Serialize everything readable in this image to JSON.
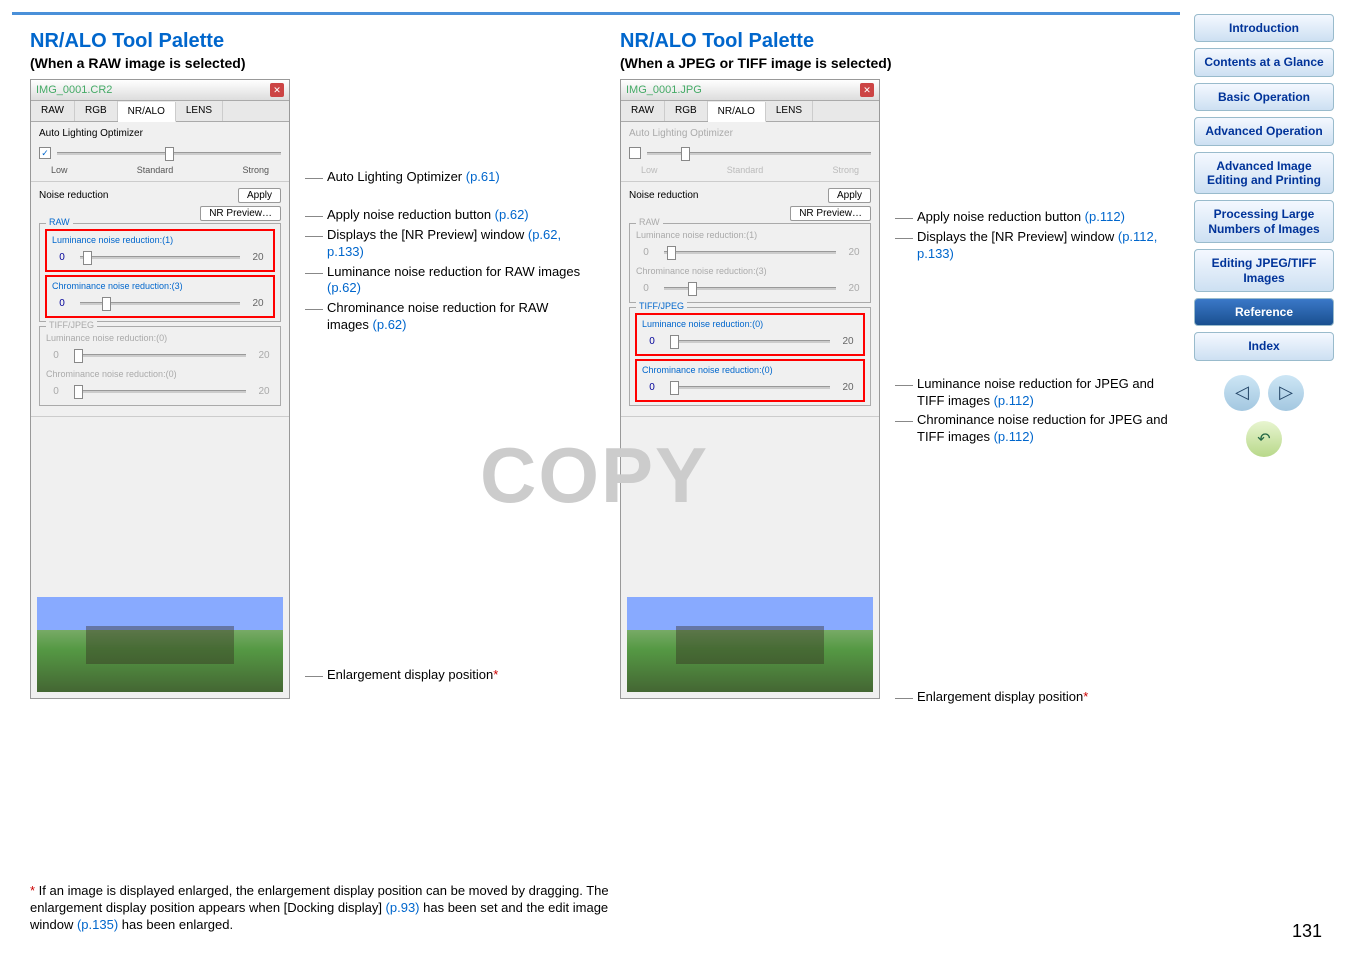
{
  "page_number": "131",
  "watermark": "COPY",
  "left": {
    "heading": "NR/ALO Tool Palette",
    "sub": "(When a RAW image is selected)",
    "panel": {
      "title": "IMG_0001.CR2",
      "tabs": [
        "RAW",
        "RGB",
        "NR/ALO",
        "LENS"
      ],
      "alo_title": "Auto Lighting Optimizer",
      "alo_labels": [
        "Low",
        "Standard",
        "Strong"
      ],
      "nr_title": "Noise reduction",
      "apply": "Apply",
      "nr_preview": "NR Preview…",
      "raw_label": "RAW",
      "lum_label": "Luminance noise reduction:(1)",
      "lum_val": "0",
      "lum_max": "20",
      "chrom_label": "Chrominance noise reduction:(3)",
      "chrom_val": "0",
      "chrom_max": "20",
      "tiff_label": "TIFF/JPEG",
      "tlum_label": "Luminance noise reduction:(0)",
      "tlum_val": "0",
      "tlum_max": "20",
      "tchrom_label": "Chrominance noise reduction:(0)",
      "tchrom_val": "0",
      "tchrom_max": "20"
    },
    "annot": {
      "a1": "Auto Lighting Optimizer ",
      "a1_link": "(p.61)",
      "a2": "Apply noise reduction button ",
      "a2_link": "(p.62)",
      "a3": "Displays the [NR Preview] window ",
      "a3_link": "(p.62, p.133)",
      "a4": "Luminance noise reduction for RAW images ",
      "a4_link": "(p.62)",
      "a5": "Chrominance noise reduction for RAW images ",
      "a5_link": "(p.62)",
      "a6": "Enlargement display position",
      "a6_star": "*"
    }
  },
  "right": {
    "heading": "NR/ALO Tool Palette",
    "sub": "(When a JPEG or TIFF image is selected)",
    "panel": {
      "title": "IMG_0001.JPG",
      "tabs": [
        "RAW",
        "RGB",
        "NR/ALO",
        "LENS"
      ],
      "alo_title": "Auto Lighting Optimizer",
      "alo_labels": [
        "Low",
        "Standard",
        "Strong"
      ],
      "nr_title": "Noise reduction",
      "apply": "Apply",
      "nr_preview": "NR Preview…",
      "raw_label": "RAW",
      "lum_label": "Luminance noise reduction:(1)",
      "lum_val": "0",
      "lum_max": "20",
      "chrom_label": "Chrominance noise reduction:(3)",
      "chrom_val": "0",
      "chrom_max": "20",
      "tiff_label": "TIFF/JPEG",
      "tlum_label": "Luminance noise reduction:(0)",
      "tlum_val": "0",
      "tlum_max": "20",
      "tchrom_label": "Chrominance noise reduction:(0)",
      "tchrom_val": "0",
      "tchrom_max": "20"
    },
    "annot": {
      "a2": "Apply noise reduction button ",
      "a2_link": "(p.112)",
      "a3": "Displays the [NR Preview] window ",
      "a3_link": "(p.112, p.133)",
      "a4": "Luminance noise reduction for JPEG and TIFF images ",
      "a4_link": "(p.112)",
      "a5": "Chrominance noise reduction for JPEG and TIFF images ",
      "a5_link": "(p.112)",
      "a6": "Enlargement display position",
      "a6_star": "*"
    }
  },
  "footnote": {
    "star": "*",
    "t1": " If an image is displayed enlarged, the enlargement display position can be moved by dragging. The enlargement display position appears when [Docking display] ",
    "l1": "(p.93)",
    "t2": " has been set and the edit image window ",
    "l2": "(p.135)",
    "t3": " has been enlarged."
  },
  "nav": {
    "intro": "Introduction",
    "contents": "Contents at a Glance",
    "basic": "Basic Operation",
    "adv_op": "Advanced Operation",
    "adv_img": "Advanced Image Editing and Printing",
    "proc": "Processing Large Numbers of Images",
    "editing": "Editing JPEG/TIFF Images",
    "ref": "Reference",
    "index": "Index"
  }
}
